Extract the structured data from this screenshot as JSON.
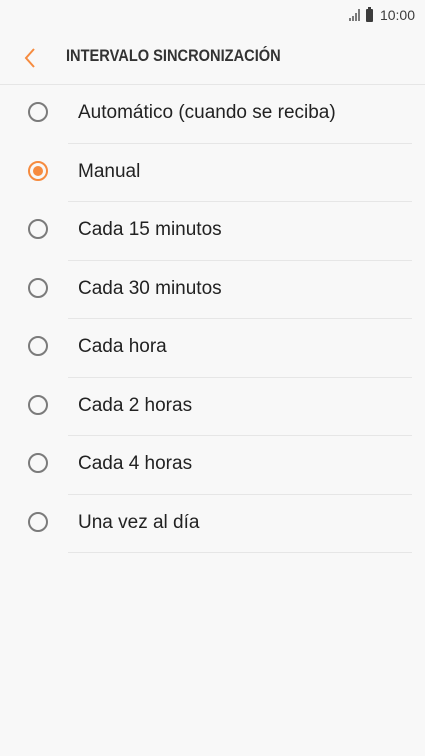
{
  "status_bar": {
    "time": "10:00",
    "signal_icon": "signal-icon",
    "battery_icon": "battery-icon"
  },
  "header": {
    "back_icon": "chevron-left-icon",
    "title": "INTERVALO SINCRONIZACIÓN"
  },
  "accent_color": "#f68b3f",
  "options": [
    {
      "label": "Automático (cuando se reciba)",
      "selected": false
    },
    {
      "label": "Manual",
      "selected": true
    },
    {
      "label": "Cada 15 minutos",
      "selected": false
    },
    {
      "label": "Cada 30 minutos",
      "selected": false
    },
    {
      "label": "Cada hora",
      "selected": false
    },
    {
      "label": "Cada 2 horas",
      "selected": false
    },
    {
      "label": "Cada 4 horas",
      "selected": false
    },
    {
      "label": "Una vez al día",
      "selected": false
    }
  ]
}
